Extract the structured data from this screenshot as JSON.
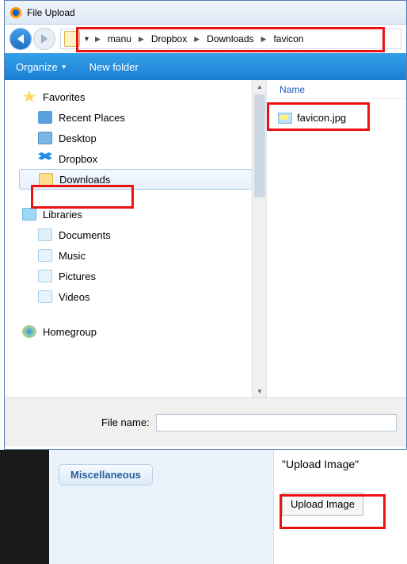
{
  "window": {
    "title": "File Upload"
  },
  "nav": {
    "crumbs": [
      "manu",
      "Dropbox",
      "Downloads",
      "favicon"
    ]
  },
  "toolbar": {
    "organize": "Organize",
    "newfolder": "New folder"
  },
  "tree": {
    "favorites": {
      "label": "Favorites",
      "items": [
        {
          "label": "Recent Places",
          "icon": "recent"
        },
        {
          "label": "Desktop",
          "icon": "desktop"
        },
        {
          "label": "Dropbox",
          "icon": "dropbox"
        },
        {
          "label": "Downloads",
          "icon": "folder",
          "selected": true
        }
      ]
    },
    "libraries": {
      "label": "Libraries",
      "items": [
        {
          "label": "Documents",
          "icon": "doc"
        },
        {
          "label": "Music",
          "icon": "music"
        },
        {
          "label": "Pictures",
          "icon": "pic"
        },
        {
          "label": "Videos",
          "icon": "vid"
        }
      ]
    },
    "homegroup": {
      "label": "Homegroup"
    }
  },
  "files": {
    "col_name": "Name",
    "items": [
      {
        "name": "favicon.jpg"
      }
    ]
  },
  "footer": {
    "filename_label": "File name:",
    "filename_value": ""
  },
  "below": {
    "misc_label": "Miscellaneous",
    "quoted": "\"Upload Image\"",
    "upload_btn": "Upload Image"
  }
}
